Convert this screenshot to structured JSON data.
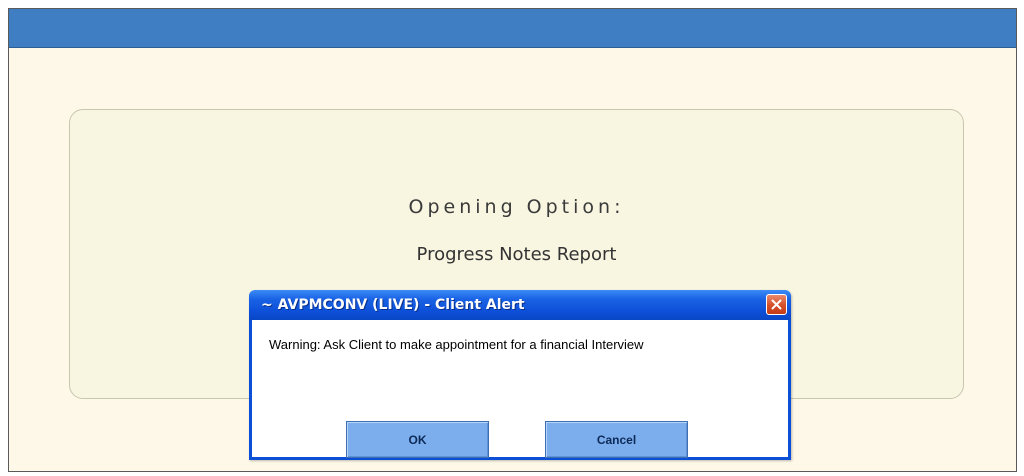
{
  "opening": {
    "label": "Opening Option:",
    "value": "Progress Notes Report"
  },
  "dialog": {
    "title": "~ AVPMCONV (LIVE) - Client Alert",
    "message": "Warning: Ask Client to make appointment for a financial Interview",
    "ok_label": "OK",
    "cancel_label": "Cancel",
    "close_icon": "close-icon"
  },
  "colors": {
    "header_bar": "#3f7ec3",
    "page_background": "#fdf8e7",
    "panel_background": "#f8f6e1",
    "dialog_titlebar": "#0d50d9",
    "dialog_button": "#7caeee",
    "close_button": "#d54f28"
  }
}
